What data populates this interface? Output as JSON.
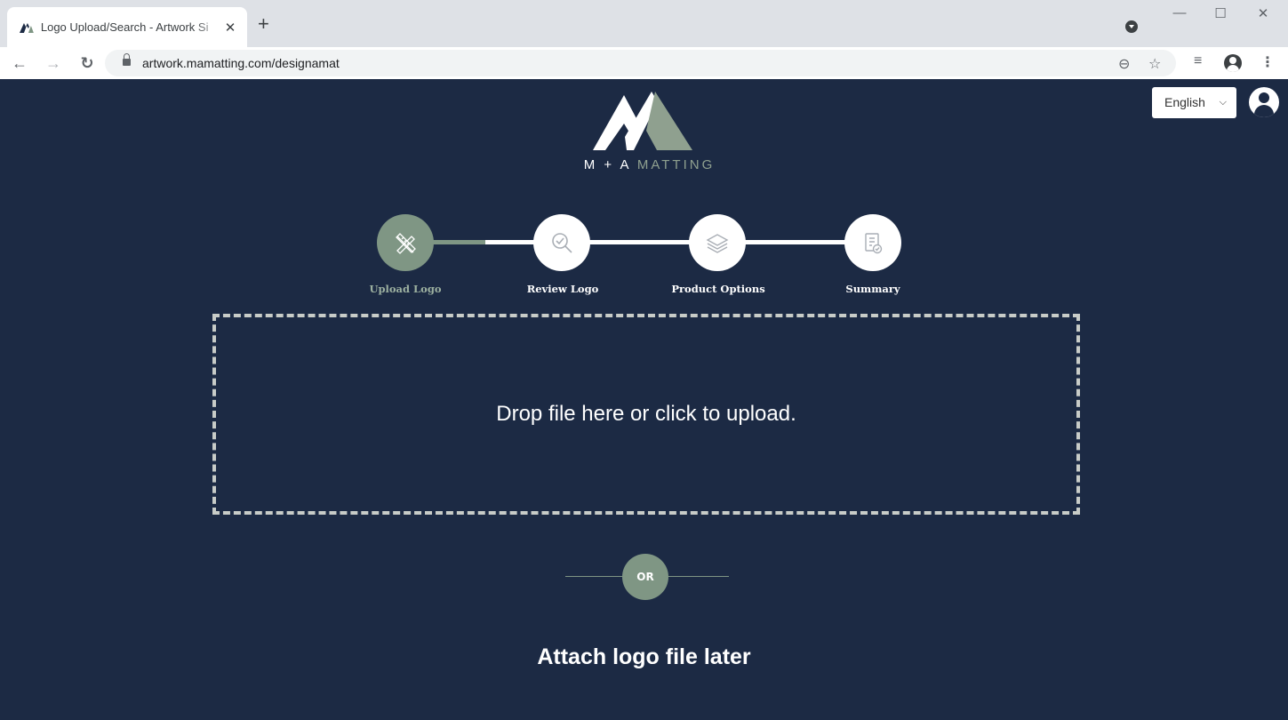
{
  "browser": {
    "tab_title": "Logo Upload/Search - Artwork Si",
    "tab_close": "✕",
    "new_tab": "+",
    "url": "artwork.mamatting.com/designamat",
    "window_controls": {
      "minimize": "—",
      "maximize": "☐",
      "close": "✕"
    },
    "nav": {
      "back": "←",
      "forward": "→",
      "reload": "↻"
    },
    "icons": [
      "zoom-icon",
      "star-icon",
      "reading-list-icon",
      "profile-icon",
      "menu-icon"
    ],
    "menu_glyph": "⋮",
    "star_glyph": "☆",
    "zoom_glyph": "⊖",
    "reading_list_glyph": "≡"
  },
  "header": {
    "language": "English",
    "language_caret": "❯",
    "logo_text_primary": "M + A",
    "logo_text_secondary": "MATTING"
  },
  "stepper": {
    "steps": [
      {
        "label": "Upload Logo",
        "icon": "pencil-ruler-icon",
        "active": true
      },
      {
        "label": "Review Logo",
        "icon": "magnify-check-icon",
        "active": false
      },
      {
        "label": "Product Options",
        "icon": "layers-icon",
        "active": false
      },
      {
        "label": "Summary",
        "icon": "clipboard-check-icon",
        "active": false
      }
    ]
  },
  "upload": {
    "dropzone_text": "Drop file here or click to upload.",
    "or_text": "OR",
    "attach_later": "Attach logo file later"
  },
  "colors": {
    "page_bg": "#1c2a44",
    "accent": "#7f9684",
    "active_label": "#9cb0a0"
  }
}
